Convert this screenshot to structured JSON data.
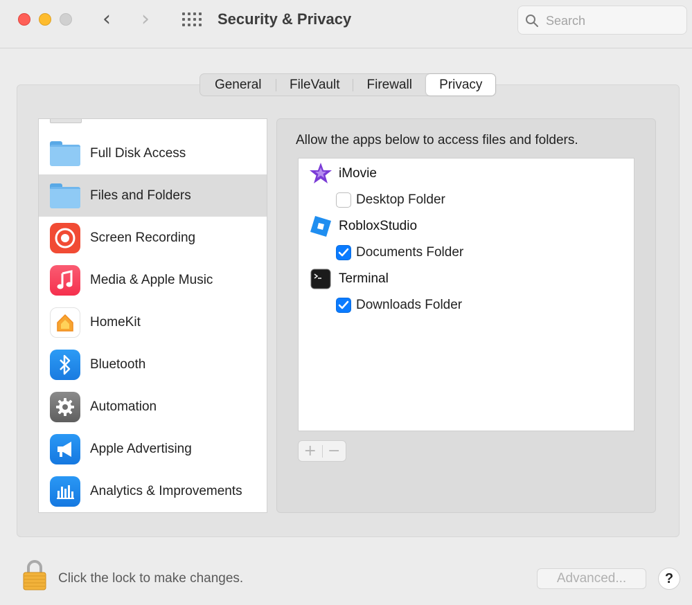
{
  "window": {
    "title": "Security & Privacy",
    "back_glyph": "‹",
    "forward_glyph": "›"
  },
  "search": {
    "placeholder": "Search",
    "value": ""
  },
  "tabs": [
    {
      "label": "General",
      "selected": false
    },
    {
      "label": "FileVault",
      "selected": false
    },
    {
      "label": "Firewall",
      "selected": false
    },
    {
      "label": "Privacy",
      "selected": true
    }
  ],
  "sidebar": {
    "items": [
      {
        "label": "Full Disk Access",
        "icon": "folder-icon",
        "selected": false
      },
      {
        "label": "Files and Folders",
        "icon": "folder-icon",
        "selected": true
      },
      {
        "label": "Screen Recording",
        "icon": "screen-recording-icon",
        "selected": false
      },
      {
        "label": "Media & Apple Music",
        "icon": "music-note-icon",
        "selected": false
      },
      {
        "label": "HomeKit",
        "icon": "home-icon",
        "selected": false
      },
      {
        "label": "Bluetooth",
        "icon": "bluetooth-icon",
        "selected": false
      },
      {
        "label": "Automation",
        "icon": "gear-icon",
        "selected": false
      },
      {
        "label": "Apple Advertising",
        "icon": "megaphone-icon",
        "selected": false
      },
      {
        "label": "Analytics & Improvements",
        "icon": "analytics-bars-icon",
        "selected": false
      }
    ]
  },
  "content": {
    "description": "Allow the apps below to access files and folders.",
    "apps": [
      {
        "name": "iMovie",
        "icon": "imovie-star-icon",
        "folders": [
          {
            "label": "Desktop Folder",
            "checked": false
          }
        ]
      },
      {
        "name": "RobloxStudio",
        "icon": "roblox-studio-icon",
        "folders": [
          {
            "label": "Documents Folder",
            "checked": true
          }
        ]
      },
      {
        "name": "Terminal",
        "icon": "terminal-icon",
        "folders": [
          {
            "label": "Downloads Folder",
            "checked": true
          }
        ]
      }
    ],
    "add_glyph": "+",
    "remove_glyph": "−"
  },
  "footer": {
    "lock_text": "Click the lock to make changes.",
    "advanced_label": "Advanced...",
    "help_label": "?"
  },
  "colors": {
    "accent": "#0a7bff",
    "close": "#fe5f57",
    "minimize": "#febc2e"
  }
}
